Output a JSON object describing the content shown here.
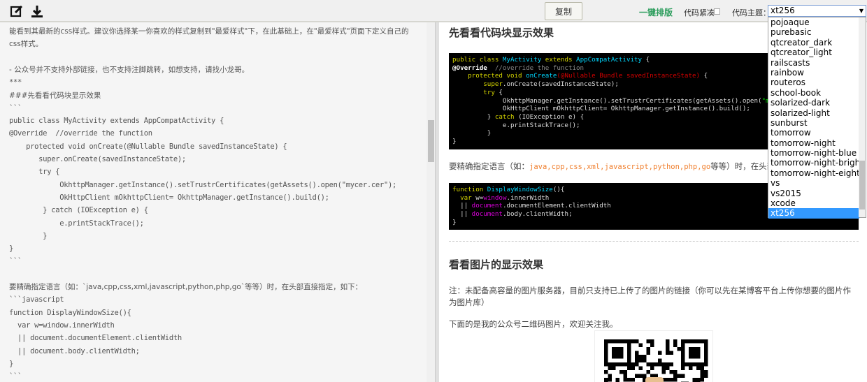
{
  "toolbar": {
    "copy_label": "复制",
    "format_label": "一键排版",
    "compact_label": "代码紧凑",
    "theme_label": "代码主题：",
    "theme_value": "xt256"
  },
  "theme_options": [
    "pojoaque",
    "purebasic",
    "qtcreator_dark",
    "qtcreator_light",
    "railscasts",
    "rainbow",
    "routeros",
    "school-book",
    "solarized-dark",
    "solarized-light",
    "sunburst",
    "tomorrow",
    "tomorrow-night",
    "tomorrow-night-blue",
    "tomorrow-night-bright",
    "tomorrow-night-eighties",
    "vs",
    "vs2015",
    "xcode",
    "xt256"
  ],
  "editor_lines": [
    "能看到其最新的css样式。建议你选择某一你喜欢的样式复制到\"最爱样式\"下，在此基础上，在\"最爱样式\"页面下定义自己的",
    "css样式。",
    "",
    "- 公众号并不支持外部链接，也不支持注脚跳转，如想支持，请找小龙哥。",
    "***",
    "###先看看代码块显示效果",
    "```",
    "public class MyActivity extends AppCompatActivity {",
    "@Override  //override the function",
    "    protected void onCreate(@Nullable Bundle savedInstanceState) {",
    "       super.onCreate(savedInstanceState);",
    "       try {",
    "            OkhttpManager.getInstance().setTrustrCertificates(getAssets().open(\"mycer.cer\");",
    "            OkHttpClient mOkhttpClient= OkhttpManager.getInstance().build();",
    "        } catch (IOException e) {",
    "            e.printStackTrace();",
    "        }",
    "}",
    "```",
    "",
    "要精确指定语言（如：`java,cpp,css,xml,javascript,python,php,go`等等）时，在头部直接指定，如下：",
    "```javascript",
    "function DisplayWindowSize(){",
    "  var w=window.innerWidth",
    "  || document.documentElement.clientWidth",
    "  || document.body.clientWidth;",
    "}",
    "```"
  ],
  "preview": {
    "heading1": "先看看代码块显示效果",
    "code1": [
      [
        [
          "public class ",
          "k"
        ],
        [
          "MyActivity ",
          "t"
        ],
        [
          "extends ",
          "k"
        ],
        [
          "AppCompatActivity ",
          "t"
        ],
        [
          "{",
          ""
        ]
      ],
      [
        [
          "@Override",
          "b"
        ],
        [
          "  //override the function",
          "c"
        ]
      ],
      [
        [
          "    protected void ",
          "k"
        ],
        [
          "onCreate",
          "t"
        ],
        [
          "(@Nullable Bundle savedInstanceState)",
          "r"
        ],
        [
          " {",
          ""
        ]
      ],
      [
        [
          "        super",
          "k"
        ],
        [
          ".onCreate(savedInstanceState);",
          ""
        ]
      ],
      [
        [
          "        try ",
          "k"
        ],
        [
          "{",
          ""
        ]
      ],
      [
        [
          "             OkhttpManager.getInstance().setTrustrCertificates(getAssets().open(",
          ""
        ],
        [
          "\"mycer.cer\"",
          "s"
        ],
        [
          ");",
          ""
        ]
      ],
      [
        [
          "             OkHttpClient mOkhttpClient= OkhttpManager.getInstance().build();",
          ""
        ]
      ],
      [
        [
          "         } ",
          ""
        ],
        [
          "catch ",
          "k"
        ],
        [
          "(IOException e) {",
          ""
        ]
      ],
      [
        [
          "             e.printStackTrace();",
          ""
        ]
      ],
      [
        [
          "         }",
          ""
        ]
      ],
      [
        [
          "}",
          ""
        ]
      ]
    ],
    "para1_before": "要精确指定语言（如：",
    "para1_code": "java,cpp,css,xml,javascript,python,php,go",
    "para1_after": "等等）时，在头部直接指定，如下：",
    "code2": [
      [
        [
          "function ",
          "k"
        ],
        [
          "DisplayWindowSize",
          "t"
        ],
        [
          "(){",
          ""
        ]
      ],
      [
        [
          "  var ",
          "k"
        ],
        [
          "w=",
          ""
        ],
        [
          "window",
          "m"
        ],
        [
          ".innerWidth",
          ""
        ]
      ],
      [
        [
          "  || ",
          ""
        ],
        [
          "document",
          "m"
        ],
        [
          ".documentElement.clientWidth",
          ""
        ]
      ],
      [
        [
          "  || ",
          ""
        ],
        [
          "document",
          "m"
        ],
        [
          ".body.clientWidth;",
          ""
        ]
      ],
      [
        [
          "}",
          ""
        ]
      ]
    ],
    "heading2": "看看图片的显示效果",
    "para2": "注：未配备高容量的图片服务器，目前只支持已上传了的图片的链接（你可以先在某博客平台上传你想要的图片作为图片库）",
    "para3": "下面的是我的公众号二维码图片，欢迎关注我。"
  }
}
